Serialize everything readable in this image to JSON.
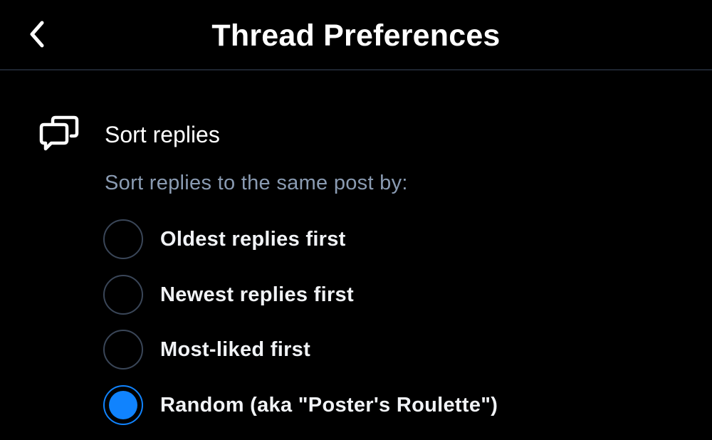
{
  "header": {
    "title": "Thread Preferences",
    "back_icon": "chevron-left-icon"
  },
  "section": {
    "icon": "chat-bubbles-icon",
    "title": "Sort replies",
    "description": "Sort replies to the same post by:"
  },
  "options": [
    {
      "label": "Oldest replies first",
      "selected": false
    },
    {
      "label": "Newest replies first",
      "selected": false
    },
    {
      "label": "Most-liked first",
      "selected": false
    },
    {
      "label": "Random (aka \"Poster's Roulette\")",
      "selected": true
    }
  ],
  "colors": {
    "background": "#000000",
    "accent": "#1083fe",
    "muted_text": "#8a9bb2",
    "divider": "#1e2530",
    "radio_border": "#3a4658"
  }
}
